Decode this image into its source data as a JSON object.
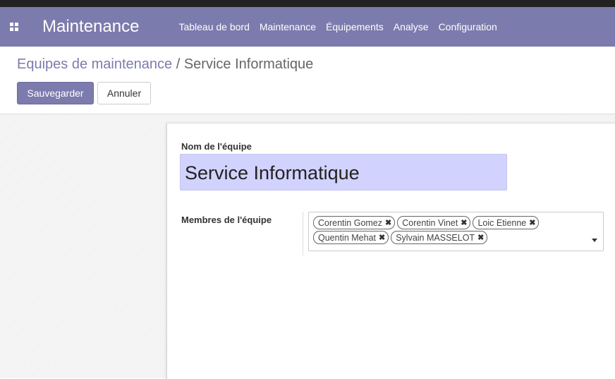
{
  "navbar": {
    "app_title": "Maintenance",
    "menu": [
      "Tableau de bord",
      "Maintenance",
      "Équipements",
      "Analyse",
      "Configuration"
    ],
    "apps_icon": "grid-apps-icon",
    "background": "#7c7bad"
  },
  "breadcrumb": {
    "parent": "Equipes de maintenance",
    "separator": "/",
    "current": "Service Informatique"
  },
  "actions": {
    "save_label": "Sauvegarder",
    "cancel_label": "Annuler"
  },
  "form": {
    "team_name_label": "Nom de l'équipe",
    "team_name_value": "Service Informatique",
    "members_label": "Membres de l'équipe",
    "members": [
      "Corentin Gomez",
      "Corentin Vinet",
      "Loic Etienne",
      "Quentin Mehat",
      "Sylvain MASSELOT"
    ],
    "remove_icon": "close-x-icon"
  },
  "colors": {
    "accent": "#7c7bad",
    "input_highlight": "#d2d2ff"
  }
}
